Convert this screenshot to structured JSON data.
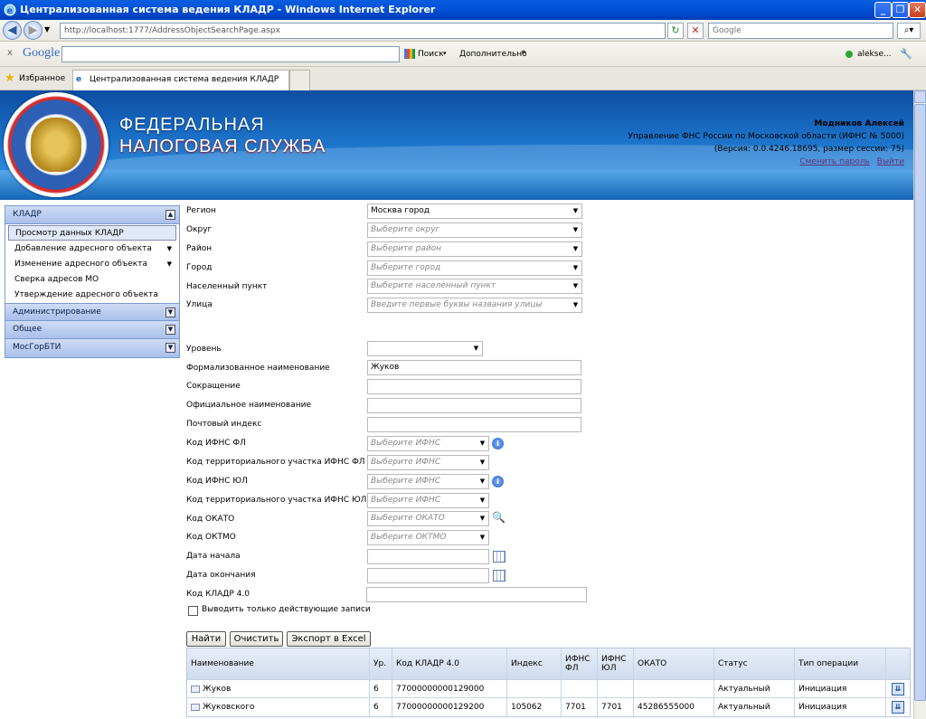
{
  "window": {
    "title": "Централизованная система ведения КЛАДР - Windows Internet Explorer"
  },
  "address": {
    "url": "http://localhost:1777/AddressObjectSearchPage.aspx",
    "search_placeholder": "Google"
  },
  "toolbar": {
    "close_x": "x",
    "google": "Google",
    "search_label": "Поиск",
    "more_label": "Дополнительно",
    "user": "alekse..."
  },
  "favorites": {
    "label": "Избранное",
    "tab_title": "Централизованная система ведения КЛАДР"
  },
  "header": {
    "brand_line1": "ФЕДЕРАЛЬНАЯ",
    "brand_line2": "НАЛОГОВАЯ СЛУЖБА",
    "user_name": "Модников Алексей",
    "org": "Управление ФНС России по Московской области (ИФНС № 5000)",
    "version": "(Версия: 0.0.4246.18695, размер сессии: 75)",
    "change_password": "Сменить пароль",
    "logout": "Выйти"
  },
  "menu": {
    "groups": [
      {
        "title": "КЛАДР",
        "arrow": "▲",
        "items": [
          {
            "label": "Просмотр данных КЛАДР",
            "selected": true,
            "dropdown": ""
          },
          {
            "label": "Добавление адресного объекта",
            "dropdown": "▼"
          },
          {
            "label": "Изменение адресного объекта",
            "dropdown": "▼"
          },
          {
            "label": "Сверка адресов МО",
            "dropdown": ""
          },
          {
            "label": "Утверждение адресного объекта",
            "dropdown": ""
          }
        ]
      },
      {
        "title": "Администрирование",
        "arrow": "▼"
      },
      {
        "title": "Общее",
        "arrow": "▼"
      },
      {
        "title": "МосГорБТИ",
        "arrow": "▼"
      }
    ]
  },
  "form": {
    "region": {
      "label": "Регион",
      "value": "Москва город"
    },
    "okrug": {
      "label": "Округ",
      "placeholder": "Выберите округ"
    },
    "raion": {
      "label": "Район",
      "placeholder": "Выберите район"
    },
    "gorod": {
      "label": "Город",
      "placeholder": "Выберите город"
    },
    "np": {
      "label": "Населенный пункт",
      "placeholder": "Выберите населенный пункт"
    },
    "ulica": {
      "label": "Улица",
      "placeholder": "Введите первые буквы названия улицы"
    },
    "uroven": {
      "label": "Уровень",
      "value": ""
    },
    "formal": {
      "label": "Формализованное наименование",
      "value": "Жуков"
    },
    "sokr": {
      "label": "Сокращение",
      "value": ""
    },
    "official": {
      "label": "Официальное наименование",
      "value": ""
    },
    "index": {
      "label": "Почтовый индекс",
      "value": ""
    },
    "ifnsfl": {
      "label": "Код ИФНС ФЛ",
      "placeholder": "Выберите ИФНС"
    },
    "terrfl": {
      "label": "Код территориального участка ИФНС ФЛ",
      "placeholder": "Выберите ИФНС"
    },
    "ifnsul": {
      "label": "Код ИФНС ЮЛ",
      "placeholder": "Выберите ИФНС"
    },
    "terrul": {
      "label": "Код территориального участка ИФНС ЮЛ",
      "placeholder": "Выберите ИФНС"
    },
    "okato": {
      "label": "Код ОКАТО",
      "placeholder": "Выберите ОКАТО"
    },
    "oktmo": {
      "label": "Код ОКТМО",
      "placeholder": "Выберите ОКТМО"
    },
    "date_start": {
      "label": "Дата начала",
      "value": ""
    },
    "date_end": {
      "label": "Дата окончания",
      "value": ""
    },
    "kladr": {
      "label": "Код КЛАДР 4.0",
      "value": ""
    },
    "only_active": {
      "label": "Выводить только действующие записи",
      "checked": false
    },
    "buttons": {
      "find": "Найти",
      "clear": "Очистить",
      "export": "Экспорт в Excel"
    }
  },
  "grid": {
    "columns": [
      "Наименование",
      "Ур.",
      "Код КЛАДР 4.0",
      "Индекс",
      "ИФНС ФЛ",
      "ИФНС ЮЛ",
      "ОКАТО",
      "Статус",
      "Тип операции"
    ],
    "rows": [
      {
        "name": "Жуков",
        "level": "6",
        "kladr": "77000000000129000",
        "index": "",
        "ifnsfl": "",
        "ifnsul": "",
        "okato": "",
        "status": "Актуальный",
        "op": "Инициация"
      },
      {
        "name": "Жуковского",
        "level": "6",
        "kladr": "77000000000129200",
        "index": "105062",
        "ifnsfl": "7701",
        "ifnsul": "7701",
        "okato": "45286555000",
        "status": "Актуальный",
        "op": "Инициация"
      }
    ]
  }
}
